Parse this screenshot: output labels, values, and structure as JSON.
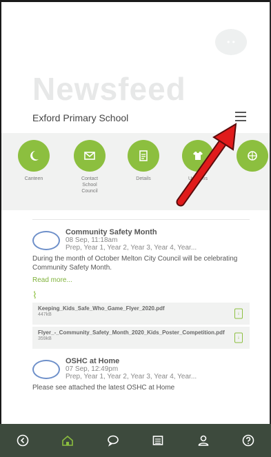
{
  "header": {
    "title": "Newsfeed",
    "school_name": "Exford Primary School"
  },
  "quick_links": [
    {
      "label": "Canteen",
      "icon": "moon-icon"
    },
    {
      "label": "Contact School Council",
      "icon": "envelope-icon"
    },
    {
      "label": "Details",
      "icon": "document-icon"
    },
    {
      "label": "Uniforms",
      "icon": "shirt-icon"
    }
  ],
  "posts": [
    {
      "title": "Community Safety Month",
      "date": "08 Sep, 11:18am",
      "audience": "Prep, Year 1, Year 2, Year 3, Year 4, Year...",
      "body": "During the month of October Melton City Council will be celebrating Community Safety Month.",
      "read_more": "Read more...",
      "attachments": [
        {
          "name": "Keeping_Kids_Safe_Who_Game_Flyer_2020.pdf",
          "size": "447kB"
        },
        {
          "name": "Flyer_-_Community_Safety_Month_2020_Kids_Poster_Competition.pdf",
          "size": "359kB"
        }
      ]
    },
    {
      "title": "OSHC at Home",
      "date": "07 Sep, 12:49pm",
      "audience": "Prep, Year 1, Year 2, Year 3, Year 4, Year...",
      "body": "Please see attached the latest OSHC at Home"
    }
  ],
  "bottom_nav": [
    "back-icon",
    "home-icon",
    "chat-icon",
    "calendar-icon",
    "profile-icon",
    "help-icon"
  ],
  "colors": {
    "accent_green": "#8cbf3f",
    "nav_bar": "#3d4a3d",
    "annotation_arrow": "#e01b1b"
  }
}
